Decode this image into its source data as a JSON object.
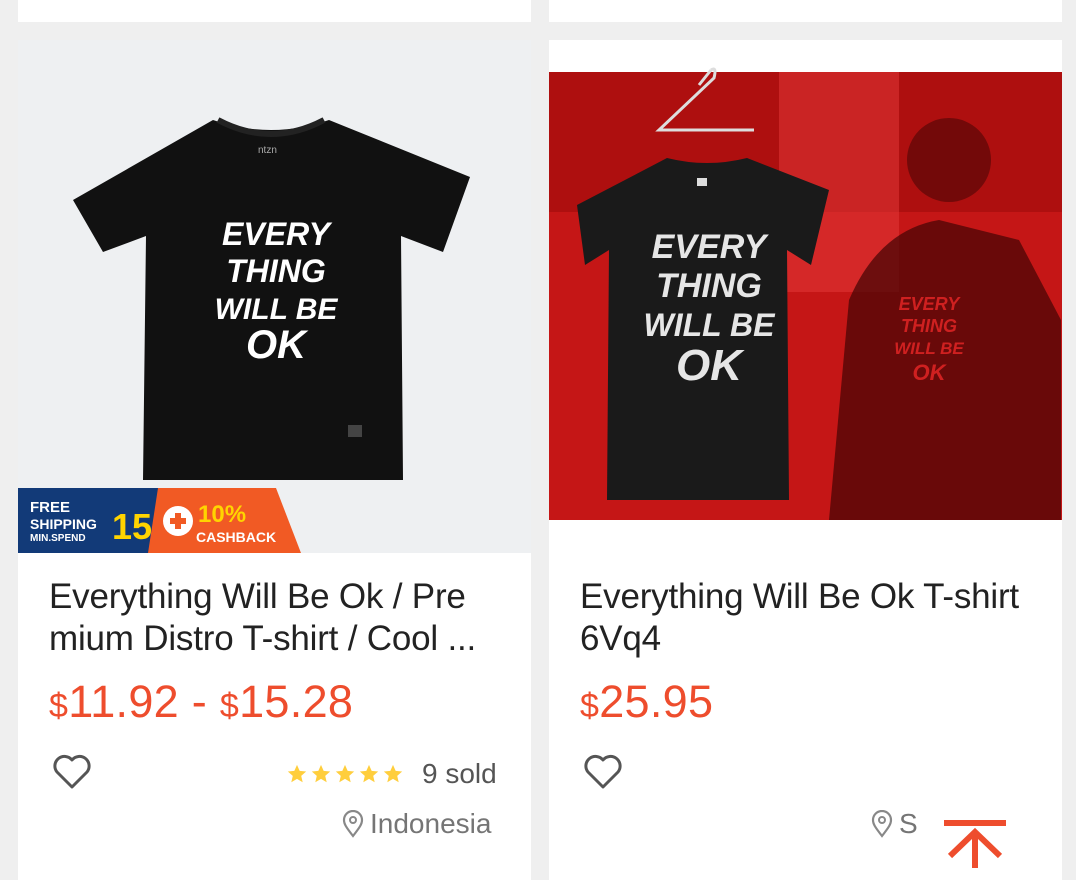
{
  "products": [
    {
      "title": "Everything Will Be Ok / Pre mium Distro T-shirt / Cool ...",
      "price_low_cur": "$",
      "price_low": "11.92",
      "price_sep": " - ",
      "price_high_cur": "$",
      "price_high": "15.28",
      "rating_stars": 5,
      "sold": "9 sold",
      "location": "Indonesia",
      "shirt_text": [
        "EVERY",
        "THING",
        "WILL BE",
        "OK"
      ],
      "tag": "ntzn",
      "promo": {
        "free": "FREE",
        "shipping": "SHIPPING",
        "minspend": "MIN.SPEND",
        "amount": "15",
        "percent": "10%",
        "cashback": "CASHBACK"
      }
    },
    {
      "title": "Everything Will Be Ok T-shirt 6Vq4",
      "price_cur": "$",
      "price": "25.95",
      "location": "S",
      "shirt_text": [
        "EVERY",
        "THING",
        "WILL BE",
        "OK"
      ]
    }
  ],
  "colors": {
    "accent": "#ee4d2d",
    "star": "#ffce3d",
    "promo_blue": "#123a78",
    "promo_orange": "#f15a24",
    "promo_yellow": "#ffd400"
  },
  "icons": {
    "favorite": "heart-outline-icon",
    "location": "location-pin-icon",
    "back_to_top": "arrow-up-to-line-icon"
  }
}
